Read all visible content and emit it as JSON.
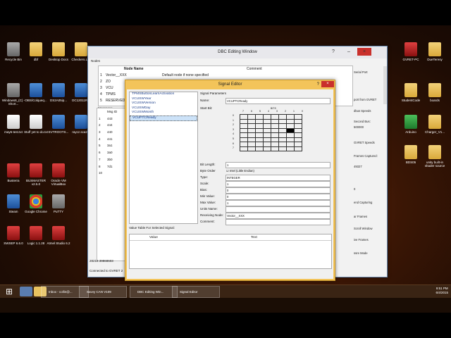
{
  "desktop": {
    "left_icons": [
      {
        "label": "Recycle Bin",
        "icon": "recycle-bin-icon"
      },
      {
        "label": "dbf",
        "icon": "folder-icon"
      },
      {
        "label": "Desktop Docs",
        "icon": "folder-icon"
      },
      {
        "label": "Checkers.LIN",
        "icon": "folder-icon"
      },
      {
        "label": "Windows8_(C) - Short...",
        "icon": "drive-icon"
      },
      {
        "label": "OBS/Colqueq...",
        "icon": "file-icon"
      },
      {
        "label": "DS2A05ip...",
        "icon": "file-icon"
      },
      {
        "label": "DC12011R...",
        "icon": "file-icon"
      },
      {
        "label": "may6-test.txt",
        "icon": "text-file-icon"
      },
      {
        "label": "Stuff yet to do.txt",
        "icon": "text-file-icon"
      },
      {
        "label": "EVTROOTS...",
        "icon": "file-icon"
      },
      {
        "label": "raycz.sca2...",
        "icon": "file-icon"
      },
      {
        "label": "Busterra",
        "icon": "app-icon"
      },
      {
        "label": "BUSMASTER v2.5.0",
        "icon": "app-icon"
      },
      {
        "label": "Oracle VM VirtualBox",
        "icon": "app-icon"
      },
      {
        "label": "Steam",
        "icon": "steam-icon"
      },
      {
        "label": "Google Chrome",
        "icon": "chrome-icon"
      },
      {
        "label": "PuTTY",
        "icon": "putty-icon"
      },
      {
        "label": "SWSEP 6.6.0",
        "icon": "app-icon"
      },
      {
        "label": "Logic 1.1.28",
        "icon": "app-icon"
      },
      {
        "label": "Atmel Studio 6.2",
        "icon": "app-icon"
      }
    ],
    "right_icons": [
      {
        "label": "GVRET-PC",
        "icon": "app-icon"
      },
      {
        "label": "DueTeresy",
        "icon": "folder-icon"
      },
      {
        "label": "boards",
        "icon": "folder-icon"
      },
      {
        "label": "StudentCode",
        "icon": "folder-icon"
      },
      {
        "label": "Arduino",
        "icon": "arduino-icon"
      },
      {
        "label": "Charger_V1...",
        "icon": "folder-icon"
      },
      {
        "label": "BDS05",
        "icon": "folder-icon"
      },
      {
        "label": "unity built-in shader source",
        "icon": "folder-icon"
      }
    ]
  },
  "dbc_window": {
    "title": "DBC Editing Window",
    "controls": [
      "?",
      "–",
      "×"
    ],
    "nodes_label": "Nodes",
    "columns": [
      "Node Name",
      "Comment"
    ],
    "nodes": [
      {
        "id": "1",
        "name": "Vector__XXX",
        "comment": "Default node if none specified"
      },
      {
        "id": "2",
        "name": "ZO",
        "comment": ""
      },
      {
        "id": "3",
        "name": "VCU",
        "comment": ""
      },
      {
        "id": "4",
        "name": "TPMS",
        "comment": ""
      },
      {
        "id": "5",
        "name": "RESERVED_E...",
        "comment": ""
      }
    ],
    "messages_label": "Messages",
    "msg_header": "Msg ID",
    "messages": [
      {
        "id": "1",
        "msg": "443"
      },
      {
        "id": "2",
        "msg": "444"
      },
      {
        "id": "3",
        "msg": "440"
      },
      {
        "id": "4",
        "msg": "441"
      },
      {
        "id": "5",
        "msg": "3a1"
      },
      {
        "id": "6",
        "msg": "3a0"
      },
      {
        "id": "7",
        "msg": "3b0"
      },
      {
        "id": "8",
        "msg": "7d1"
      },
      {
        "id": "10",
        "msg": ""
      }
    ],
    "id_row": "28218  39868603",
    "status": "Connected to GVRET 2"
  },
  "right_panel": {
    "items": [
      "Serial Port",
      "port from GVRET",
      "dbus Speeds",
      "Second Bus:",
      "500000",
      "GVRET Speeds",
      "Frames Captured:",
      "49327",
      "0",
      "end Capturing",
      "ar Frames",
      "Scroll Window",
      "ive Frames",
      "ssre Mode"
    ]
  },
  "signal_editor": {
    "title": "Signal Editor",
    "controls": [
      "?",
      "×"
    ],
    "signals": [
      "TPMSButtonLearnActivation",
      "VCUSWYear",
      "VCUSWVersion",
      "VCUSWDay",
      "VCUSWMonth",
      "VCUPTCReady"
    ],
    "selected": "VCUPTCReady",
    "section_label": "Signal Parameters",
    "name_label": "Name:",
    "name_value": "VCUPTCReady",
    "start_bit_label": "Start Bit:",
    "bit_header": "BITS",
    "bit_cols": [
      "7",
      "6",
      "5",
      "4",
      "3",
      "2",
      "1",
      "0"
    ],
    "byte_rows": [
      "0",
      "1",
      "2",
      "3",
      "4",
      "5",
      "6",
      "7"
    ],
    "on_cell": {
      "row": 3,
      "col": 6
    },
    "bit_length_label": "Bit Length:",
    "bit_length": "1",
    "byte_order_label": "Byte Order",
    "byte_order": "Intel (Little Endian)",
    "type_label": "Type:",
    "type": "INTEGER",
    "scale_label": "Scale:",
    "scale": "1",
    "bias_label": "Bias:",
    "bias": "0",
    "min_label": "Min Value:",
    "min": "0",
    "max_label": "Max Value:",
    "max": "1",
    "units_label": "Units Name:",
    "units": "",
    "recv_label": "Receiving Node:",
    "recv": "Vector__XXX",
    "comment_label": "Comment:",
    "comment": "",
    "value_table_label": "Value Table For Selected Signal:",
    "value_cols": [
      "Value",
      "Text"
    ]
  },
  "taskbar": {
    "tasks": [
      {
        "label": "Inbox - collin@..."
      },
      {
        "label": "Savvy CAN V109"
      },
      {
        "label": "DBC Editing Win..."
      },
      {
        "label": "Signal Editor"
      }
    ],
    "time": "9:51 PM",
    "date": "6/4/2015"
  }
}
